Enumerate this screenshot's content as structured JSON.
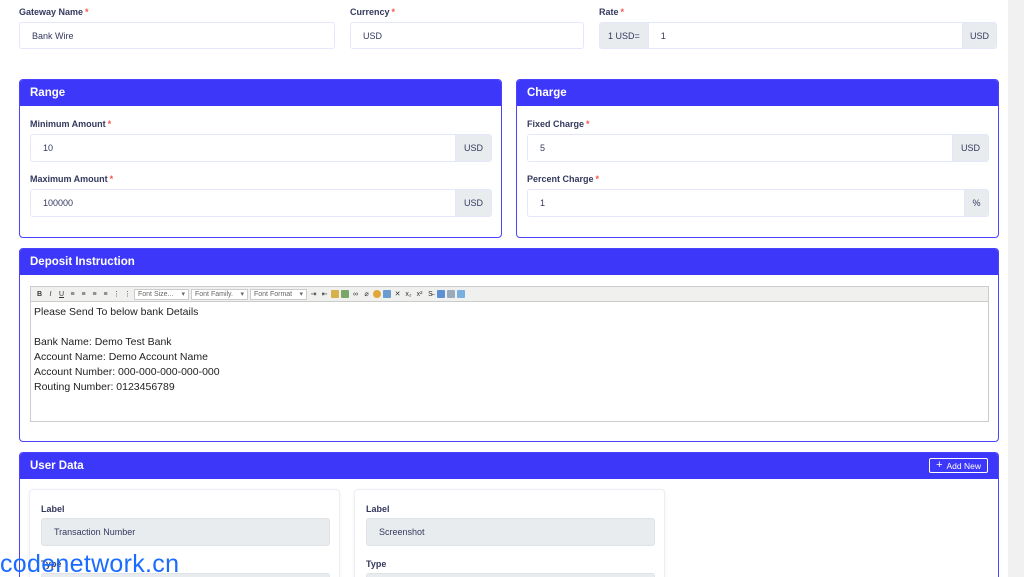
{
  "top": {
    "gateway_name": {
      "label": "Gateway Name",
      "value": "Bank Wire"
    },
    "currency": {
      "label": "Currency",
      "value": "USD"
    },
    "rate": {
      "label": "Rate",
      "prefix": "1 USD=",
      "value": "1",
      "suffix": "USD"
    },
    "required_mark": "*"
  },
  "range": {
    "title": "Range",
    "min": {
      "label": "Minimum Amount",
      "value": "10",
      "suffix": "USD"
    },
    "max": {
      "label": "Maximum Amount",
      "value": "100000",
      "suffix": "USD"
    }
  },
  "charge": {
    "title": "Charge",
    "fixed": {
      "label": "Fixed Charge",
      "value": "5",
      "suffix": "USD"
    },
    "percent": {
      "label": "Percent Charge",
      "value": "1",
      "suffix": "%"
    }
  },
  "deposit": {
    "title": "Deposit Instruction",
    "toolbar": {
      "bold": "B",
      "italic": "I",
      "underline": "U",
      "font_size": "Font Size...",
      "font_family": "Font Family.",
      "font_format": "Font Format",
      "subscript": "x₂",
      "superscript": "x²"
    },
    "lines": [
      "Please Send To below bank Details",
      "",
      "Bank Name: Demo Test Bank",
      "Account Name: Demo Account Name",
      "Account Number: 000-000-000-000-000",
      "Routing Number: 0123456789"
    ]
  },
  "user_data": {
    "title": "User Data",
    "add_new": "Add New",
    "add_icon": "plus-icon",
    "fields": [
      {
        "label_title": "Label",
        "label_value": "Transaction Number",
        "type_title": "Type"
      },
      {
        "label_title": "Label",
        "label_value": "Screenshot",
        "type_title": "Type"
      }
    ]
  },
  "watermark": "codenetwork.cn",
  "colors": {
    "primary": "#3d37f9",
    "required": "#fc544b",
    "watermark": "#1a6bff"
  }
}
